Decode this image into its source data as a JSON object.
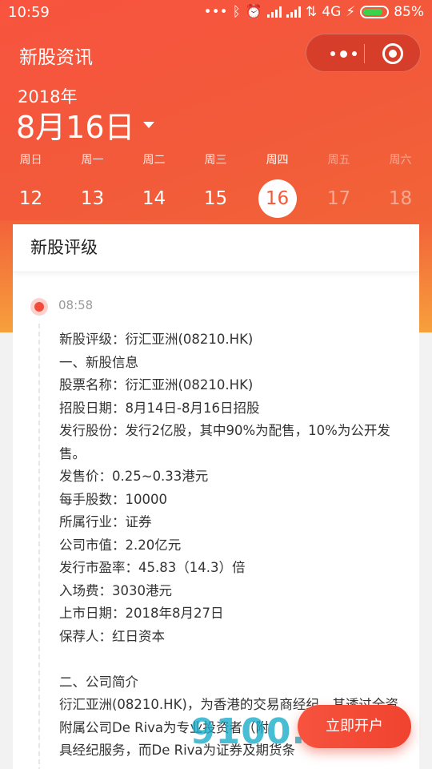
{
  "status_bar": {
    "time": "10:59",
    "icons_left_of_network": [
      "more-dots-icon",
      "bluetooth-icon",
      "alarm-icon",
      "signal-icon",
      "signal-icon",
      "data-arrows-icon"
    ],
    "network": "4G",
    "battery_percent": "85%",
    "battery_level": 0.85
  },
  "app": {
    "title": "新股资讯",
    "capsule": {
      "more_icon": "more-dots-icon",
      "close_icon": "target-close-icon"
    }
  },
  "date": {
    "year": "2018年",
    "month_day": "8月16日"
  },
  "week": [
    {
      "weekday": "周日",
      "day": "12",
      "state": "past"
    },
    {
      "weekday": "周一",
      "day": "13",
      "state": "past"
    },
    {
      "weekday": "周二",
      "day": "14",
      "state": "past"
    },
    {
      "weekday": "周三",
      "day": "15",
      "state": "past"
    },
    {
      "weekday": "周四",
      "day": "16",
      "state": "selected"
    },
    {
      "weekday": "周五",
      "day": "17",
      "state": "future"
    },
    {
      "weekday": "周六",
      "day": "18",
      "state": "future"
    }
  ],
  "card": {
    "title": "新股评级",
    "entry": {
      "time": "08:58",
      "lines": [
        "新股评级：衍汇亚洲(08210.HK)",
        "一、新股信息",
        "股票名称：衍汇亚洲(08210.HK)",
        "招股日期：8月14日-8月16日招股",
        "发行股份：发行2亿股，其中90%为配售，10%为公开发售。",
        "发售价：0.25~0.33港元",
        "每手股数：10000",
        "所属行业：证券",
        "公司市值：2.20亿元",
        "发行市盈率：45.83（14.3）倍",
        "入场费：3030港元",
        "上市日期：2018年8月27日",
        "保荐人：红日资本",
        "",
        "二、公司简介",
        "衍汇亚洲(08210.HK)，为香港的交易商经纪，其透过全资附属公司De Riva为专业投资者（附",
        "具经纪服务，而De Riva为证券及期货条"
      ]
    }
  },
  "fab": {
    "label": "立即开户"
  },
  "watermark": "9100.com",
  "colors": {
    "brand_red": "#f25a3a",
    "accent_orange": "#f6a03c",
    "fab_red": "#f0432f",
    "battery_green": "#3ad14c"
  }
}
